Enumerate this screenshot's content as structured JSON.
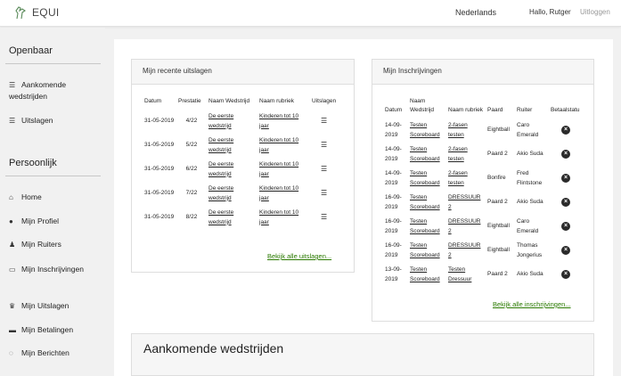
{
  "topbar": {
    "brand": "EQUI",
    "language": "Nederlands",
    "greeting": "Hallo, Rutger",
    "logout": "Uitloggen"
  },
  "sidebar": {
    "public_title": "Openbaar",
    "public_items": [
      {
        "label": "Aankomende wedstrijden",
        "icon": "list-icon"
      },
      {
        "label": "Uitslagen",
        "icon": "list-icon"
      }
    ],
    "personal_title": "Persoonlijk",
    "personal_items": [
      {
        "label": "Home",
        "icon": "home-icon"
      },
      {
        "label": "Mijn Profiel",
        "icon": "user-icon"
      },
      {
        "label": "Mijn Ruiters",
        "icon": "users-icon"
      },
      {
        "label": "Mijn Inschrijvingen",
        "icon": "id-card-icon"
      },
      {
        "label": "Mijn Uitslagen",
        "icon": "trophy-icon"
      },
      {
        "label": "Mijn Betalingen",
        "icon": "credit-card-icon"
      },
      {
        "label": "Mijn Berichten",
        "icon": "comments-icon"
      }
    ]
  },
  "results": {
    "title": "Mijn recente uitslagen",
    "headers": [
      "Datum",
      "Prestatie",
      "Naam Wedstrijd",
      "Naam rubriek",
      "Uitslagen"
    ],
    "rows": [
      {
        "date": "31-05-2019",
        "score": "4/22",
        "competition": "De eerste wedstrijd",
        "rubric": "Kinderen tot 10 jaar"
      },
      {
        "date": "31-05-2019",
        "score": "5/22",
        "competition": "De eerste wedstrijd",
        "rubric": "Kinderen tot 10 jaar"
      },
      {
        "date": "31-05-2019",
        "score": "6/22",
        "competition": "De eerste wedstrijd",
        "rubric": "Kinderen tot 10 jaar"
      },
      {
        "date": "31-05-2019",
        "score": "7/22",
        "competition": "De eerste wedstrijd",
        "rubric": "Kinderen tot 10 jaar"
      },
      {
        "date": "31-05-2019",
        "score": "8/22",
        "competition": "De eerste wedstrijd",
        "rubric": "Kinderen tot 10 jaar"
      }
    ],
    "more_link": "Bekijk alle uitslagen..."
  },
  "entries": {
    "title": "Mijn Inschrijvingen",
    "headers": [
      "Datum",
      "Naam Wedstrijd",
      "Naam rubriek",
      "Paard",
      "Ruiter",
      "Betaalstatu"
    ],
    "rows": [
      {
        "date": "14-09-2019",
        "competition": "Testen Scoreboard",
        "rubric": "2-fasen testen",
        "horse": "Eightball",
        "rider": "Caro Emerald"
      },
      {
        "date": "14-09-2019",
        "competition": "Testen Scoreboard",
        "rubric": "2-fasen testen",
        "horse": "Paard 2",
        "rider": "Akio Suda"
      },
      {
        "date": "14-09-2019",
        "competition": "Testen Scoreboard",
        "rubric": "2-fasen testen",
        "horse": "Bonfire",
        "rider": "Fred Flintstone"
      },
      {
        "date": "16-09-2019",
        "competition": "Testen Scoreboard",
        "rubric": "DRESSUUR 2",
        "horse": "Paard 2",
        "rider": "Akio Suda"
      },
      {
        "date": "16-09-2019",
        "competition": "Testen Scoreboard",
        "rubric": "DRESSUUR 2",
        "horse": "Eightball",
        "rider": "Caro Emerald"
      },
      {
        "date": "16-09-2019",
        "competition": "Testen Scoreboard",
        "rubric": "DRESSUUR 2",
        "horse": "Eightball",
        "rider": "Thomas Jongerius"
      },
      {
        "date": "13-09-2019",
        "competition": "Testen Scoreboard",
        "rubric": "Testen Dressuur",
        "horse": "Paard 2",
        "rider": "Akio Suda"
      }
    ],
    "more_link": "Bekijk alle inschrijvingen..."
  },
  "upcoming": {
    "title": "Aankomende wedstrijden"
  }
}
